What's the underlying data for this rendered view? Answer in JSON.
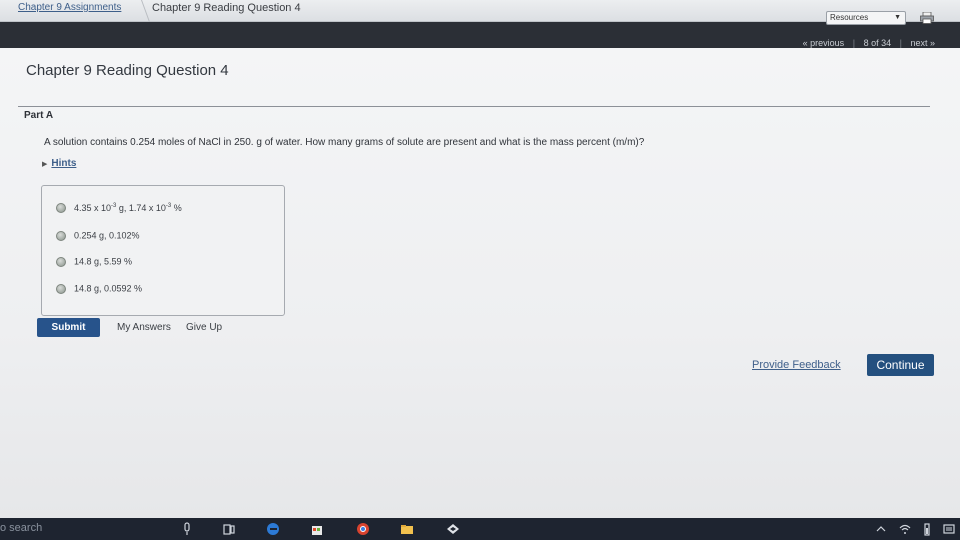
{
  "breadcrumb": {
    "parent": "Chapter 9 Assignments",
    "current": "Chapter 9 Reading Question 4"
  },
  "toolbar": {
    "resources_label": "Resources",
    "print_icon": "printer-icon"
  },
  "pager": {
    "previous_label": "« previous",
    "position": "8 of 34",
    "next_label": "next »"
  },
  "page": {
    "title": "Chapter 9 Reading Question 4"
  },
  "question": {
    "part_label": "Part A",
    "text": "A solution contains 0.254 moles of NaCl in 250. g of water. How many grams of solute are present and what is the mass percent (m/m)?",
    "hints_label": "Hints"
  },
  "choices": [
    {
      "a": "4.35 x 10",
      "a_exp": "-3",
      "b": " g, 1.74 x 10",
      "b_exp": "-3",
      "c": " %"
    },
    {
      "a": "0.254 g, 0.102%",
      "a_exp": "",
      "b": "",
      "b_exp": "",
      "c": ""
    },
    {
      "a": "14.8 g, 5.59 %",
      "a_exp": "",
      "b": "",
      "b_exp": "",
      "c": ""
    },
    {
      "a": "14.8 g, 0.0592 %",
      "a_exp": "",
      "b": "",
      "b_exp": "",
      "c": ""
    }
  ],
  "actions": {
    "submit_label": "Submit",
    "my_answers_label": "My Answers",
    "give_up_label": "Give Up",
    "feedback_label": "Provide Feedback",
    "continue_label": "Continue"
  },
  "taskbar": {
    "search_text": "o search"
  },
  "colors": {
    "link": "#3e5f8a",
    "primary_button": "#27538b",
    "dark_bar": "#2b2f36"
  }
}
